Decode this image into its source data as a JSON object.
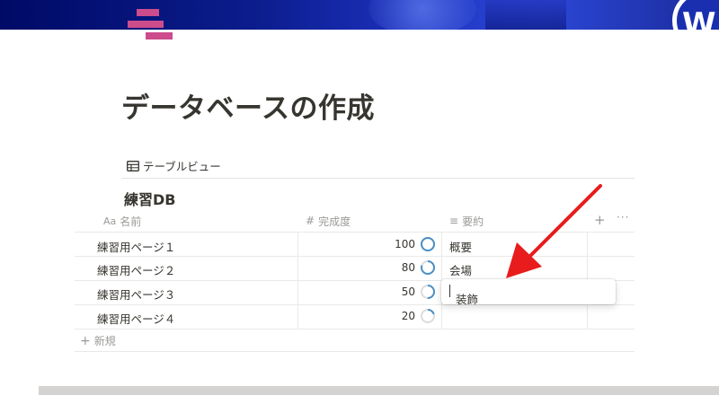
{
  "page": {
    "title": "データベースの作成"
  },
  "view": {
    "icon": "table-icon",
    "label": "テーブルビュー"
  },
  "database": {
    "title": "練習DB",
    "columns": [
      {
        "icon": "text-icon",
        "icon_glyph": "Aa",
        "label": "名前"
      },
      {
        "icon": "number-icon",
        "icon_glyph": "#",
        "label": "完成度"
      },
      {
        "icon": "lines-icon",
        "icon_glyph": "≡",
        "label": "要約"
      }
    ],
    "rows": [
      {
        "name": "練習用ページ１",
        "progress": 100,
        "summary": "概要"
      },
      {
        "name": "練習用ページ２",
        "progress": 80,
        "summary": "会場"
      },
      {
        "name": "練習用ページ３",
        "progress": 50,
        "summary": "装飾"
      },
      {
        "name": "練習用ページ４",
        "progress": 20,
        "summary": ""
      }
    ],
    "new_label": "新規",
    "add_column_glyph": "+",
    "more_glyph": "···"
  },
  "editing": {
    "value": "装飾"
  },
  "colors": {
    "accent_ring": "#4a8fc7",
    "ring_track": "#dcdcdc",
    "page_icon": "#cc4c8c",
    "arrow": "#e81c1c"
  }
}
